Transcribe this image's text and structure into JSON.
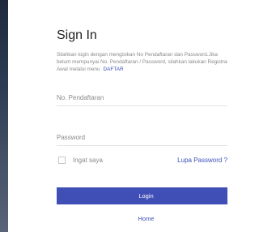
{
  "signin": {
    "title": "Sign In",
    "description": "Silahkan login dengan mengisikan No Pendaftaran dan Password.Jika belum mempunyai No. Pendaftaran / Password, silahkan lakukan Registrasi Awal melalui menu",
    "daftar_link": "DAFTAR",
    "username_placeholder": "No. Pendaftaran",
    "username_value": "",
    "password_placeholder": "Password",
    "password_value": "",
    "remember_label": "Ingat saya",
    "remember_checked": false,
    "forgot_link": "Lupa Password ?",
    "login_button": "Login",
    "home_link": "Home"
  },
  "colors": {
    "accent": "#3f4fb5",
    "sidebar": "#1e2a3c"
  }
}
